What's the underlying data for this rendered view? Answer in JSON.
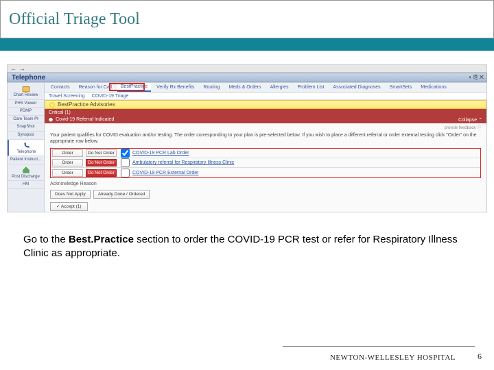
{
  "slide": {
    "title": "Official Triage Tool",
    "instruction_prefix": "Go to the ",
    "instruction_bold": "Best.Practice",
    "instruction_suffix": " section to order the COVID-19 PCR test or refer for Respiratory Illness Clinic as appropriate.",
    "footer": "NEWTON-WELLESLEY HOSPITAL",
    "page": "6"
  },
  "ehr": {
    "window_title": "Telephone",
    "sidebar": [
      {
        "label": "Chart Review"
      },
      {
        "label": "PHS Viewer"
      },
      {
        "label": "PDMP"
      },
      {
        "label": "Care Team Pt"
      },
      {
        "label": "SnapShot"
      },
      {
        "label": "Synopsis"
      },
      {
        "label": "Telephone"
      },
      {
        "label": "Patient Instruct..."
      },
      {
        "label": "Post Discharge"
      },
      {
        "label": "HM"
      }
    ],
    "tabs": [
      "Contacts",
      "Reason for Call",
      "BestPractice",
      "Verify Rx Benefits",
      "Routing",
      "Meds & Orders",
      "Allergies",
      "Problem List",
      "Associated Diagnoses",
      "SmartSets",
      "Medications"
    ],
    "subtabs": [
      "Travel Screening",
      "COVID-19 Triage"
    ],
    "bpa_header": "BestPractice Advisories",
    "critical_label": "Critical (1)",
    "referral_label": "Covid-19 Referral Indicated",
    "collapse_label": "Collapse",
    "feedback_label": "provide feedback",
    "instruction_text": "Your patient qualifies for COVID evaluation and/or testing. The order corresponding to your plan is pre-selected below. If you wish to place a different referral or order external testing click \"Order\" on the appropriate row below.",
    "orders": [
      {
        "order": "Order",
        "dno": "Do Not Order",
        "checked": true,
        "label": "COVID-19 PCR Lab Order"
      },
      {
        "order": "Order",
        "dno": "Do Not Order",
        "checked": false,
        "label": "Ambulatory referral for Respiratory Illness Clinic"
      },
      {
        "order": "Order",
        "dno": "Do Not Order",
        "checked": false,
        "label": "COVID-19 PCR External Order"
      }
    ],
    "ack_label": "Acknowledge Reason",
    "ack_buttons": [
      "Does Not Apply",
      "Already Done / Ordered"
    ],
    "accept_label": "✓ Accept (1)"
  }
}
